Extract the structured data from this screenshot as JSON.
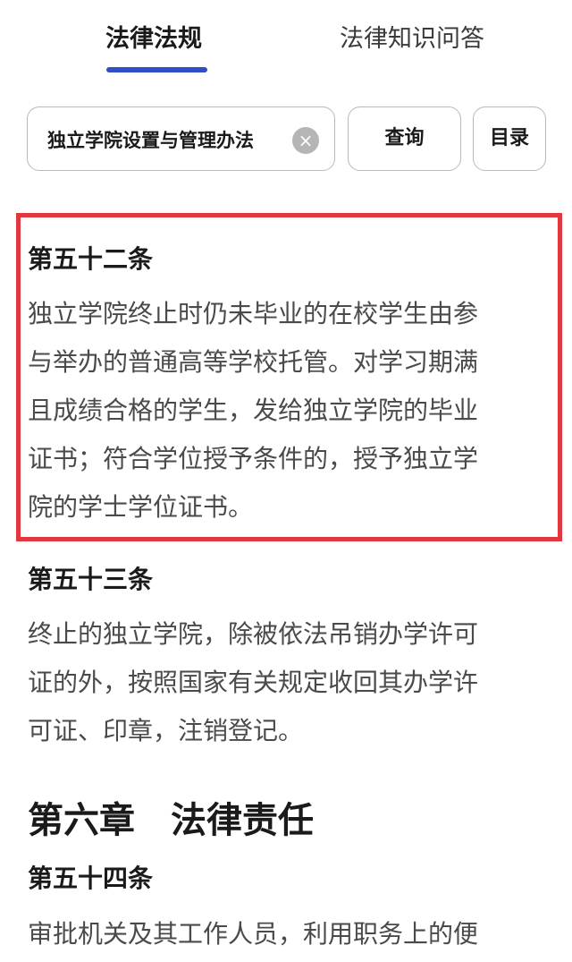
{
  "tabs": [
    {
      "label": "法律法规",
      "active": true
    },
    {
      "label": "法律知识问答",
      "active": false
    }
  ],
  "search": {
    "value": "独立学院设置与管理办法",
    "clear_icon": "×"
  },
  "buttons": {
    "query": "查询",
    "toc": "目录"
  },
  "articles": [
    {
      "title": "第五十二条",
      "lines": [
        "独立学院终止时仍未毕业的在校学生由参",
        "与举办的普通高等学校托管。对学习期满",
        "且成绩合格的学生，发给独立学院的毕业",
        "证书；符合学位授予条件的，授予独立学",
        "院的学士学位证书。"
      ]
    },
    {
      "title": "第五十三条",
      "lines": [
        "终止的独立学院，除被依法吊销办学许可",
        "证的外，按照国家有关规定收回其办学许",
        "可证、印章，注销登记。"
      ]
    },
    {
      "title": "第五十四条",
      "lines": [
        "审批机关及其工作人员，利用职务上的便"
      ]
    }
  ],
  "chapter": {
    "title": "第六章　法律责任"
  },
  "colors": {
    "accent": "#2f4fc4",
    "highlight_border": "#e2383d"
  }
}
